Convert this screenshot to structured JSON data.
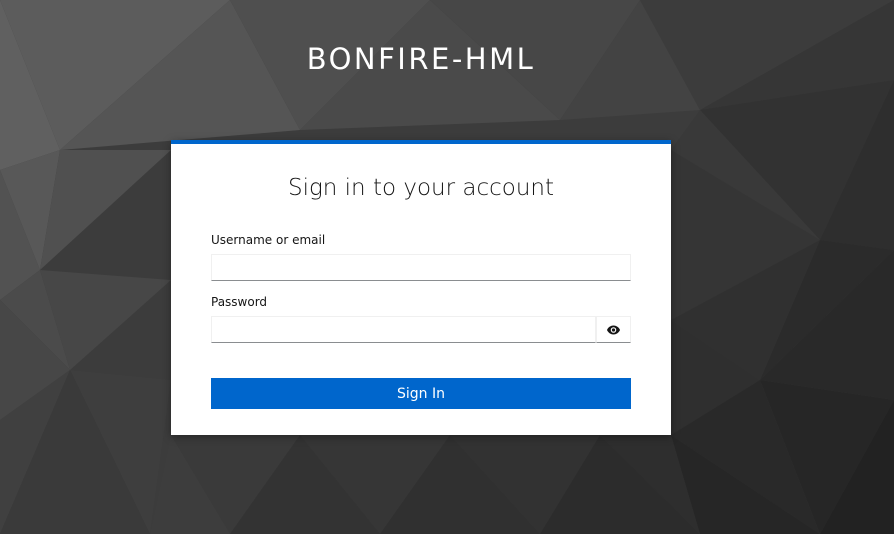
{
  "realm": {
    "title": "BONFIRE-HML"
  },
  "login_card": {
    "heading": "Sign in to your account",
    "accent_color": "#0066cc",
    "username": {
      "label": "Username or email",
      "value": "",
      "placeholder": ""
    },
    "password": {
      "label": "Password",
      "value": "",
      "placeholder": "",
      "toggle_icon": "eye-icon"
    },
    "submit_label": "Sign In"
  }
}
